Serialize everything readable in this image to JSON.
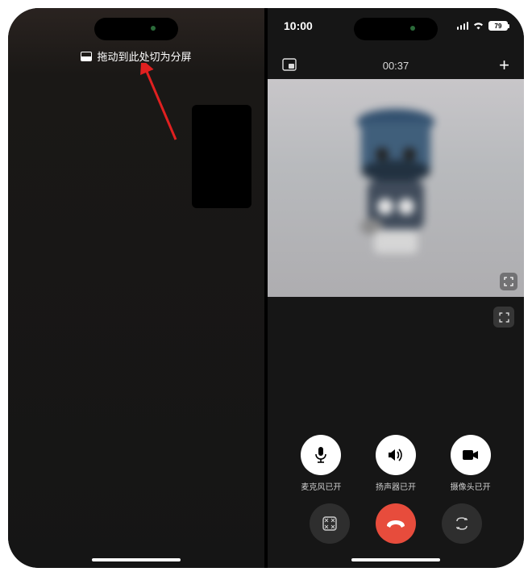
{
  "left": {
    "split_hint": "拖动到此处切为分屏",
    "split_icon": "split-view-icon"
  },
  "right": {
    "status": {
      "time": "10:00",
      "battery": "79"
    },
    "call": {
      "duration": "00:37"
    },
    "controls": {
      "mic": {
        "label": "麦克风已开"
      },
      "speaker": {
        "label": "扬声器已开"
      },
      "camera": {
        "label": "摄像头已开"
      }
    }
  }
}
